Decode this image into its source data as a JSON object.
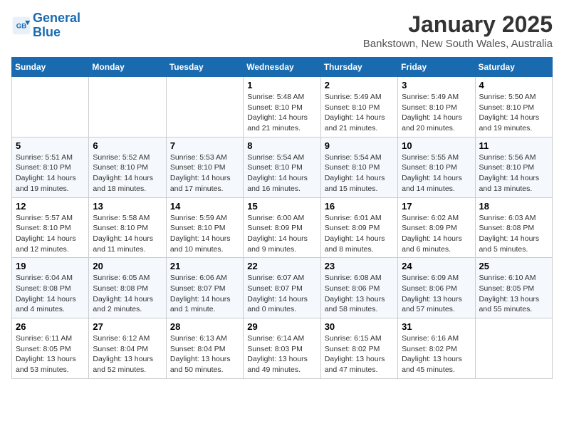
{
  "header": {
    "logo_line1": "General",
    "logo_line2": "Blue",
    "month": "January 2025",
    "location": "Bankstown, New South Wales, Australia"
  },
  "weekdays": [
    "Sunday",
    "Monday",
    "Tuesday",
    "Wednesday",
    "Thursday",
    "Friday",
    "Saturday"
  ],
  "weeks": [
    [
      {
        "num": "",
        "info": ""
      },
      {
        "num": "",
        "info": ""
      },
      {
        "num": "",
        "info": ""
      },
      {
        "num": "1",
        "info": "Sunrise: 5:48 AM\nSunset: 8:10 PM\nDaylight: 14 hours and 21 minutes."
      },
      {
        "num": "2",
        "info": "Sunrise: 5:49 AM\nSunset: 8:10 PM\nDaylight: 14 hours and 21 minutes."
      },
      {
        "num": "3",
        "info": "Sunrise: 5:49 AM\nSunset: 8:10 PM\nDaylight: 14 hours and 20 minutes."
      },
      {
        "num": "4",
        "info": "Sunrise: 5:50 AM\nSunset: 8:10 PM\nDaylight: 14 hours and 19 minutes."
      }
    ],
    [
      {
        "num": "5",
        "info": "Sunrise: 5:51 AM\nSunset: 8:10 PM\nDaylight: 14 hours and 19 minutes."
      },
      {
        "num": "6",
        "info": "Sunrise: 5:52 AM\nSunset: 8:10 PM\nDaylight: 14 hours and 18 minutes."
      },
      {
        "num": "7",
        "info": "Sunrise: 5:53 AM\nSunset: 8:10 PM\nDaylight: 14 hours and 17 minutes."
      },
      {
        "num": "8",
        "info": "Sunrise: 5:54 AM\nSunset: 8:10 PM\nDaylight: 14 hours and 16 minutes."
      },
      {
        "num": "9",
        "info": "Sunrise: 5:54 AM\nSunset: 8:10 PM\nDaylight: 14 hours and 15 minutes."
      },
      {
        "num": "10",
        "info": "Sunrise: 5:55 AM\nSunset: 8:10 PM\nDaylight: 14 hours and 14 minutes."
      },
      {
        "num": "11",
        "info": "Sunrise: 5:56 AM\nSunset: 8:10 PM\nDaylight: 14 hours and 13 minutes."
      }
    ],
    [
      {
        "num": "12",
        "info": "Sunrise: 5:57 AM\nSunset: 8:10 PM\nDaylight: 14 hours and 12 minutes."
      },
      {
        "num": "13",
        "info": "Sunrise: 5:58 AM\nSunset: 8:10 PM\nDaylight: 14 hours and 11 minutes."
      },
      {
        "num": "14",
        "info": "Sunrise: 5:59 AM\nSunset: 8:10 PM\nDaylight: 14 hours and 10 minutes."
      },
      {
        "num": "15",
        "info": "Sunrise: 6:00 AM\nSunset: 8:09 PM\nDaylight: 14 hours and 9 minutes."
      },
      {
        "num": "16",
        "info": "Sunrise: 6:01 AM\nSunset: 8:09 PM\nDaylight: 14 hours and 8 minutes."
      },
      {
        "num": "17",
        "info": "Sunrise: 6:02 AM\nSunset: 8:09 PM\nDaylight: 14 hours and 6 minutes."
      },
      {
        "num": "18",
        "info": "Sunrise: 6:03 AM\nSunset: 8:08 PM\nDaylight: 14 hours and 5 minutes."
      }
    ],
    [
      {
        "num": "19",
        "info": "Sunrise: 6:04 AM\nSunset: 8:08 PM\nDaylight: 14 hours and 4 minutes."
      },
      {
        "num": "20",
        "info": "Sunrise: 6:05 AM\nSunset: 8:08 PM\nDaylight: 14 hours and 2 minutes."
      },
      {
        "num": "21",
        "info": "Sunrise: 6:06 AM\nSunset: 8:07 PM\nDaylight: 14 hours and 1 minute."
      },
      {
        "num": "22",
        "info": "Sunrise: 6:07 AM\nSunset: 8:07 PM\nDaylight: 14 hours and 0 minutes."
      },
      {
        "num": "23",
        "info": "Sunrise: 6:08 AM\nSunset: 8:06 PM\nDaylight: 13 hours and 58 minutes."
      },
      {
        "num": "24",
        "info": "Sunrise: 6:09 AM\nSunset: 8:06 PM\nDaylight: 13 hours and 57 minutes."
      },
      {
        "num": "25",
        "info": "Sunrise: 6:10 AM\nSunset: 8:05 PM\nDaylight: 13 hours and 55 minutes."
      }
    ],
    [
      {
        "num": "26",
        "info": "Sunrise: 6:11 AM\nSunset: 8:05 PM\nDaylight: 13 hours and 53 minutes."
      },
      {
        "num": "27",
        "info": "Sunrise: 6:12 AM\nSunset: 8:04 PM\nDaylight: 13 hours and 52 minutes."
      },
      {
        "num": "28",
        "info": "Sunrise: 6:13 AM\nSunset: 8:04 PM\nDaylight: 13 hours and 50 minutes."
      },
      {
        "num": "29",
        "info": "Sunrise: 6:14 AM\nSunset: 8:03 PM\nDaylight: 13 hours and 49 minutes."
      },
      {
        "num": "30",
        "info": "Sunrise: 6:15 AM\nSunset: 8:02 PM\nDaylight: 13 hours and 47 minutes."
      },
      {
        "num": "31",
        "info": "Sunrise: 6:16 AM\nSunset: 8:02 PM\nDaylight: 13 hours and 45 minutes."
      },
      {
        "num": "",
        "info": ""
      }
    ]
  ]
}
